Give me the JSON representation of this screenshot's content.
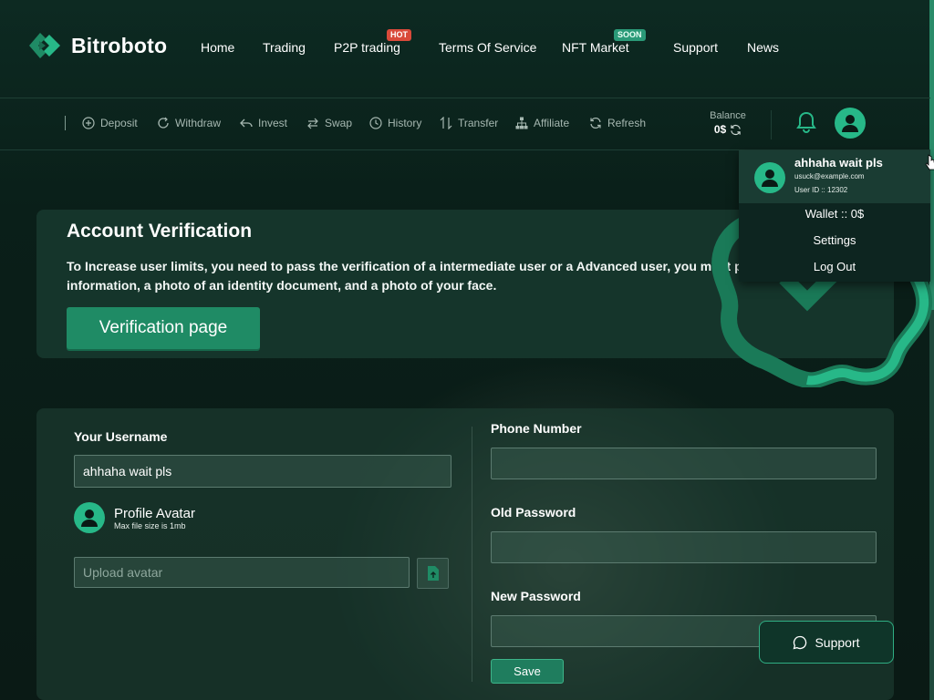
{
  "brand": {
    "name": "Bitroboto"
  },
  "nav": {
    "items": [
      {
        "label": "Home"
      },
      {
        "label": "Trading"
      },
      {
        "label": "P2P trading",
        "badge": "HOT"
      },
      {
        "label": "Terms Of Service"
      },
      {
        "label": "NFT Market",
        "badge": "SOON"
      },
      {
        "label": "Support"
      },
      {
        "label": "News"
      }
    ]
  },
  "toolbar": {
    "items": [
      {
        "label": "Deposit",
        "icon": "plus-circle-icon"
      },
      {
        "label": "Withdraw",
        "icon": "circle-arrow-icon"
      },
      {
        "label": "Invest",
        "icon": "reply-icon"
      },
      {
        "label": "Swap",
        "icon": "swap-icon"
      },
      {
        "label": "History",
        "icon": "clock-icon"
      },
      {
        "label": "Transfer",
        "icon": "transfer-icon"
      },
      {
        "label": "Affiliate",
        "icon": "network-icon"
      },
      {
        "label": "Refresh",
        "icon": "refresh-icon"
      }
    ],
    "balance_label": "Balance",
    "balance_value": "0$"
  },
  "verification": {
    "title": "Account Verification",
    "text": "To Increase user limits, you need to pass the verification of a intermediate user or a Advanced user, you must provide information, a photo of an identity document, and a photo of your face.",
    "button": "Verification page"
  },
  "form": {
    "username_label": "Your Username",
    "username_value": "ahhaha wait pls",
    "profile_avatar_label": "Profile Avatar",
    "profile_avatar_hint": "Max file size is 1mb",
    "upload_placeholder": "Upload avatar",
    "phone_label": "Phone Number",
    "phone_value": "",
    "old_password_label": "Old Password",
    "new_password_label": "New Password",
    "save_label": "Save"
  },
  "support_button": "Support",
  "user_menu": {
    "name": "ahhaha wait pls",
    "email": "usuck@example.com",
    "user_id": "User ID :: 12302",
    "wallet": "Wallet :: 0$",
    "settings": "Settings",
    "logout": "Log Out"
  },
  "colors": {
    "accent": "#27b888",
    "hot": "#d94a3a",
    "soon": "#2a9a78",
    "background": "#0a1a15"
  }
}
